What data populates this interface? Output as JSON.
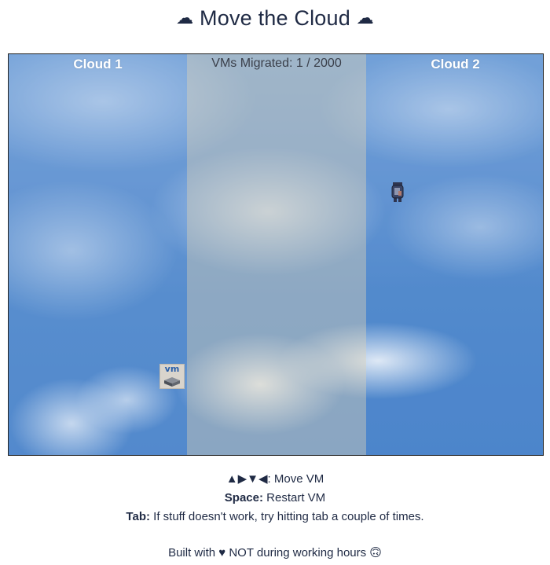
{
  "title": {
    "text": "Move the Cloud",
    "left_icon": "cloud-icon",
    "right_icon": "cloud-icon"
  },
  "game": {
    "zones": {
      "left_label": "Cloud 1",
      "right_label": "Cloud 2"
    },
    "status": {
      "label": "VMs Migrated: ",
      "migrated": "1",
      "separator": " / ",
      "total": "2000"
    },
    "vm_label": "vm"
  },
  "instructions": {
    "arrows": "▲▶▼◀",
    "arrows_text": ": Move VM",
    "space_key": "Space:",
    "space_text": " Restart VM",
    "tab_key": "Tab:",
    "tab_text": " If stuff doesn't work, try hitting tab a couple of times.",
    "credit": "Built with ♥ NOT during working hours 🙃"
  },
  "colors": {
    "text": "#1f2a44",
    "sky": "#4682c9",
    "middle_zone": "#c8c8be"
  }
}
